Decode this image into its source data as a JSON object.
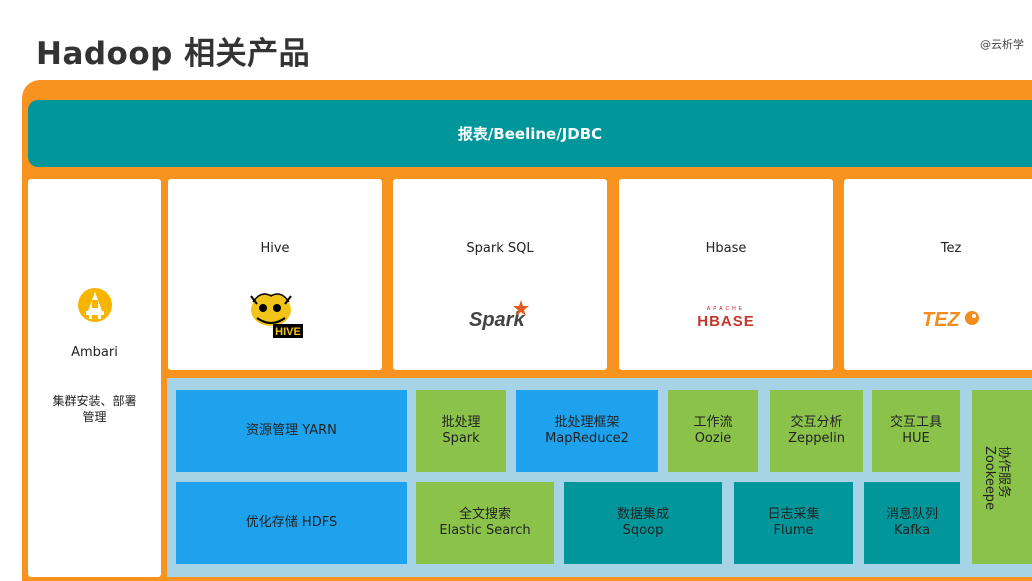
{
  "page": {
    "title": "Hadoop 相关产品",
    "watermark": "@云析学"
  },
  "banner": {
    "label": "报表/Beeline/JDBC"
  },
  "ambari": {
    "name": "Ambari",
    "desc_line1": "集群安装、部署",
    "desc_line2": "管理"
  },
  "cards": [
    {
      "name": "Hive",
      "logo_text": "HIVE"
    },
    {
      "name": "Spark SQL",
      "logo_text": "Spark"
    },
    {
      "name": "Hbase",
      "logo_text": "HBASE",
      "logo_small": "APACHE"
    },
    {
      "name": "Tez",
      "logo_text": "TEZ"
    }
  ],
  "blocks": {
    "yarn": {
      "line1": "资源管理 YARN"
    },
    "hdfs": {
      "line1": "优化存储 HDFS"
    },
    "spark": {
      "line1": "批处理",
      "line2": "Spark"
    },
    "mapreduce": {
      "line1": "批处理框架",
      "line2": "MapReduce2"
    },
    "oozie": {
      "line1": "工作流",
      "line2": "Oozie"
    },
    "zeppelin": {
      "line1": "交互分析",
      "line2": "Zeppelin"
    },
    "hue": {
      "line1": "交互工具",
      "line2": "HUE"
    },
    "elastic": {
      "line1": "全文搜索",
      "line2": "Elastic Search"
    },
    "sqoop": {
      "line1": "数据集成",
      "line2": "Sqoop"
    },
    "flume": {
      "line1": "日志采集",
      "line2": "Flume"
    },
    "kafka": {
      "line1": "消息队列",
      "line2": "Kafka"
    },
    "zookeeper": {
      "line1": "协作服务",
      "line2": "Zookeepe"
    }
  },
  "colors": {
    "frame": "#f7931e",
    "teal": "#00969a",
    "blue": "#1ea2ee",
    "green": "#8bc34a",
    "light_blue": "#a6d4e6"
  }
}
